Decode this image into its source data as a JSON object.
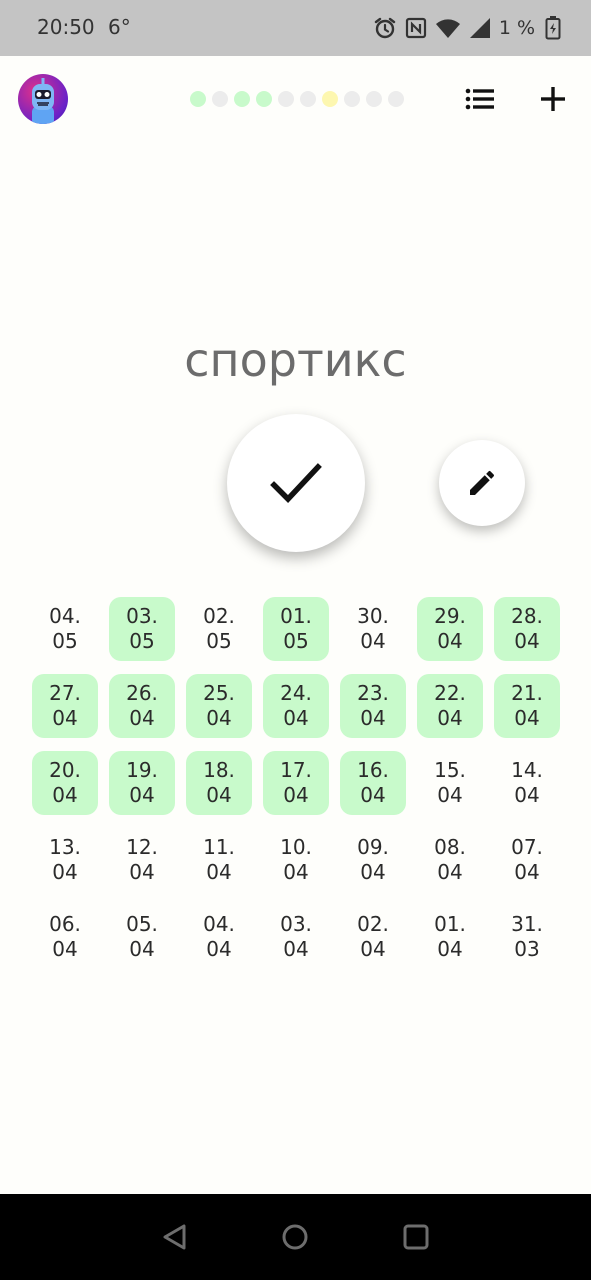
{
  "status_bar": {
    "time": "20:50",
    "temperature": "6°",
    "battery": "1 %",
    "icons": [
      "alarm-icon",
      "nfc-icon",
      "wifi-icon",
      "signal-icon",
      "battery-charging-icon"
    ]
  },
  "header": {
    "avatar_icon": "robot-avatar-icon",
    "progress_dots": [
      "#c8facb",
      "#ececec",
      "#c8facb",
      "#c8facb",
      "#ececec",
      "#ececec",
      "#fdf7b0",
      "#ececec",
      "#ececec",
      "#ececec"
    ],
    "list_icon": "list-icon",
    "add_icon": "plus-icon"
  },
  "habit": {
    "title": "спортикс",
    "check_icon": "check-icon",
    "edit_icon": "pencil-icon"
  },
  "colors": {
    "done": "#c8facb",
    "pending": "#fdf7b0",
    "empty": "#ececec"
  },
  "dates": [
    {
      "day": "04.",
      "month": "05",
      "done": false
    },
    {
      "day": "03.",
      "month": "05",
      "done": true
    },
    {
      "day": "02.",
      "month": "05",
      "done": false
    },
    {
      "day": "01.",
      "month": "05",
      "done": true
    },
    {
      "day": "30.",
      "month": "04",
      "done": false
    },
    {
      "day": "29.",
      "month": "04",
      "done": true
    },
    {
      "day": "28.",
      "month": "04",
      "done": true
    },
    {
      "day": "27.",
      "month": "04",
      "done": true
    },
    {
      "day": "26.",
      "month": "04",
      "done": true
    },
    {
      "day": "25.",
      "month": "04",
      "done": true
    },
    {
      "day": "24.",
      "month": "04",
      "done": true
    },
    {
      "day": "23.",
      "month": "04",
      "done": true
    },
    {
      "day": "22.",
      "month": "04",
      "done": true
    },
    {
      "day": "21.",
      "month": "04",
      "done": true
    },
    {
      "day": "20.",
      "month": "04",
      "done": true
    },
    {
      "day": "19.",
      "month": "04",
      "done": true
    },
    {
      "day": "18.",
      "month": "04",
      "done": true
    },
    {
      "day": "17.",
      "month": "04",
      "done": true
    },
    {
      "day": "16.",
      "month": "04",
      "done": true
    },
    {
      "day": "15.",
      "month": "04",
      "done": false
    },
    {
      "day": "14.",
      "month": "04",
      "done": false
    },
    {
      "day": "13.",
      "month": "04",
      "done": false
    },
    {
      "day": "12.",
      "month": "04",
      "done": false
    },
    {
      "day": "11.",
      "month": "04",
      "done": false
    },
    {
      "day": "10.",
      "month": "04",
      "done": false
    },
    {
      "day": "09.",
      "month": "04",
      "done": false
    },
    {
      "day": "08.",
      "month": "04",
      "done": false
    },
    {
      "day": "07.",
      "month": "04",
      "done": false
    },
    {
      "day": "06.",
      "month": "04",
      "done": false
    },
    {
      "day": "05.",
      "month": "04",
      "done": false
    },
    {
      "day": "04.",
      "month": "04",
      "done": false
    },
    {
      "day": "03.",
      "month": "04",
      "done": false
    },
    {
      "day": "02.",
      "month": "04",
      "done": false
    },
    {
      "day": "01.",
      "month": "04",
      "done": false
    },
    {
      "day": "31.",
      "month": "03",
      "done": false
    }
  ],
  "nav_bar": {
    "back_icon": "back-triangle-icon",
    "home_icon": "home-circle-icon",
    "recents_icon": "recents-square-icon"
  }
}
